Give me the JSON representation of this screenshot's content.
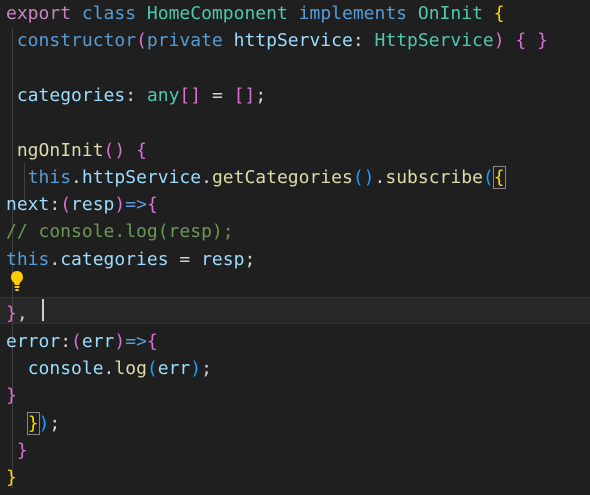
{
  "editor": {
    "lines": [
      [
        {
          "t": "export",
          "c": "ctl"
        },
        {
          "t": " ",
          "c": "op"
        },
        {
          "t": "class",
          "c": "kw"
        },
        {
          "t": " ",
          "c": "op"
        },
        {
          "t": "HomeComponent",
          "c": "cls"
        },
        {
          "t": " ",
          "c": "op"
        },
        {
          "t": "implements",
          "c": "kw"
        },
        {
          "t": " ",
          "c": "op"
        },
        {
          "t": "OnInit",
          "c": "cls"
        },
        {
          "t": " ",
          "c": "op"
        },
        {
          "t": "{",
          "c": "br1"
        }
      ],
      [
        {
          "t": " ",
          "c": "op"
        },
        {
          "t": "constructor",
          "c": "kw"
        },
        {
          "t": "(",
          "c": "br2"
        },
        {
          "t": "private",
          "c": "kw"
        },
        {
          "t": " ",
          "c": "op"
        },
        {
          "t": "httpService",
          "c": "var"
        },
        {
          "t": ": ",
          "c": "op"
        },
        {
          "t": "HttpService",
          "c": "cls"
        },
        {
          "t": ")",
          "c": "br2"
        },
        {
          "t": " ",
          "c": "op"
        },
        {
          "t": "{",
          "c": "br2"
        },
        {
          "t": " ",
          "c": "op"
        },
        {
          "t": "}",
          "c": "br2"
        }
      ],
      [],
      [
        {
          "t": " ",
          "c": "op"
        },
        {
          "t": "categories",
          "c": "var"
        },
        {
          "t": ": ",
          "c": "op"
        },
        {
          "t": "any",
          "c": "cls"
        },
        {
          "t": "[]",
          "c": "br2"
        },
        {
          "t": " = ",
          "c": "op"
        },
        {
          "t": "[]",
          "c": "br2"
        },
        {
          "t": ";",
          "c": "op"
        }
      ],
      [],
      [
        {
          "t": " ",
          "c": "op"
        },
        {
          "t": "ngOnInit",
          "c": "fn"
        },
        {
          "t": "()",
          "c": "br2"
        },
        {
          "t": " ",
          "c": "op"
        },
        {
          "t": "{",
          "c": "br2"
        }
      ],
      [
        {
          "t": "  ",
          "c": "op"
        },
        {
          "t": "this",
          "c": "kw"
        },
        {
          "t": ".",
          "c": "op"
        },
        {
          "t": "httpService",
          "c": "var"
        },
        {
          "t": ".",
          "c": "op"
        },
        {
          "t": "getCategories",
          "c": "fn"
        },
        {
          "t": "()",
          "c": "br3"
        },
        {
          "t": ".",
          "c": "op"
        },
        {
          "t": "subscribe",
          "c": "fn"
        },
        {
          "t": "(",
          "c": "br3"
        },
        {
          "t": "{",
          "c": "br1",
          "m": true
        }
      ],
      [
        {
          "t": "next",
          "c": "var"
        },
        {
          "t": ":",
          "c": "op"
        },
        {
          "t": "(",
          "c": "br2"
        },
        {
          "t": "resp",
          "c": "var"
        },
        {
          "t": ")",
          "c": "br2"
        },
        {
          "t": "=>",
          "c": "kw"
        },
        {
          "t": "{",
          "c": "br2"
        }
      ],
      [
        {
          "t": "// console.log(resp);",
          "c": "cmt"
        }
      ],
      [
        {
          "t": "this",
          "c": "kw"
        },
        {
          "t": ".",
          "c": "op"
        },
        {
          "t": "categories",
          "c": "var"
        },
        {
          "t": " = ",
          "c": "op"
        },
        {
          "t": "resp",
          "c": "var"
        },
        {
          "t": ";",
          "c": "op"
        }
      ],
      [],
      [
        {
          "t": "}",
          "c": "br2"
        },
        {
          "t": ",",
          "c": "op"
        }
      ],
      [
        {
          "t": "error",
          "c": "var"
        },
        {
          "t": ":",
          "c": "op"
        },
        {
          "t": "(",
          "c": "br2"
        },
        {
          "t": "err",
          "c": "var"
        },
        {
          "t": ")",
          "c": "br2"
        },
        {
          "t": "=>",
          "c": "kw"
        },
        {
          "t": "{",
          "c": "br2"
        }
      ],
      [
        {
          "t": "  ",
          "c": "op"
        },
        {
          "t": "console",
          "c": "var"
        },
        {
          "t": ".",
          "c": "op"
        },
        {
          "t": "log",
          "c": "fn"
        },
        {
          "t": "(",
          "c": "br3"
        },
        {
          "t": "err",
          "c": "var"
        },
        {
          "t": ")",
          "c": "br3"
        },
        {
          "t": ";",
          "c": "op"
        }
      ],
      [
        {
          "t": "}",
          "c": "br2"
        }
      ],
      [
        {
          "t": "  ",
          "c": "op"
        },
        {
          "t": "}",
          "c": "br1",
          "m": true
        },
        {
          "t": ")",
          "c": "br3"
        },
        {
          "t": ";",
          "c": "op"
        }
      ],
      [
        {
          "t": " ",
          "c": "op"
        },
        {
          "t": "}",
          "c": "br2"
        }
      ],
      [
        {
          "t": "}",
          "c": "br1"
        }
      ]
    ],
    "colors": {
      "background": "#1f1f1f",
      "keyword": "#569cd6",
      "control_keyword": "#c586c0",
      "type": "#4ec9b0",
      "function": "#dcdcaa",
      "variable": "#9cdcfe",
      "comment": "#6a9955",
      "bracket_level_1": "#ffd700",
      "bracket_level_2": "#da70d6",
      "bracket_level_3": "#179fff"
    },
    "lightbulb_icon": "lightbulb-icon"
  }
}
